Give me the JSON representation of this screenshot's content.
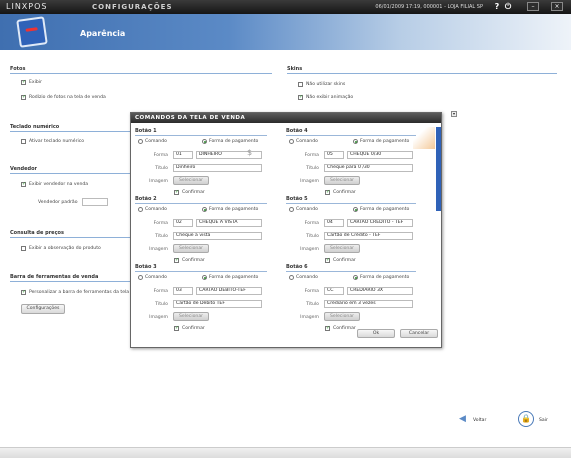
{
  "topbar": {
    "brand": "LINXPOS",
    "title": "CONFIGURAÇÕES",
    "status": "06/01/2009 17:19, 000001 - LOJA FILIAL SP",
    "help_icon": "question-icon",
    "power_icon": "power-icon"
  },
  "header": {
    "title": "Aparência"
  },
  "sections": {
    "fotos": {
      "title": "Fotos",
      "items": [
        {
          "label": "Exibir",
          "checked": true
        },
        {
          "label": "Rodízio de fotos na tela de venda",
          "checked": true
        }
      ]
    },
    "skins": {
      "title": "Skins",
      "items": [
        {
          "label": "Não utilizar skins",
          "checked": false
        },
        {
          "label": "Não exibir animação",
          "checked": true
        }
      ]
    },
    "teclado": {
      "title": "Teclado numérico",
      "items": [
        {
          "label": "Ativar teclado numérico",
          "checked": false
        }
      ]
    },
    "vendedor": {
      "title": "Vendedor",
      "items": [
        {
          "label": "Exibir vendedor na venda",
          "checked": true
        }
      ],
      "padrao_label": "Vendedor padrão",
      "padrao_value": ""
    },
    "consulta": {
      "title": "Consulta de preços",
      "items": [
        {
          "label": "Exibir a observação do produto",
          "checked": false
        }
      ]
    },
    "barra": {
      "title": "Barra de ferramentas de venda",
      "items": [
        {
          "label": "Personalizar a barra de ferramentas da tela de v",
          "checked": true
        }
      ],
      "config_button": "Configurações"
    }
  },
  "modal": {
    "title": "COMANDOS DA TELA DE VENDA",
    "radio_comando": "Comando",
    "radio_forma": "Forma de pagamento",
    "label_forma": "Forma",
    "label_titulo": "Título",
    "label_imagem": "Imagem",
    "select_button": "Selecionar",
    "confirm_label": "Confirmar",
    "ok_button": "Ok",
    "cancel_button": "Cancelar",
    "buttons": [
      {
        "name": "Botão 1",
        "code": "01",
        "desc": "DINHEIRO",
        "titulo": "Dinheiro"
      },
      {
        "name": "Botão 2",
        "code": "02",
        "desc": "CHEQUE A VISTA",
        "titulo": "Cheque a vista"
      },
      {
        "name": "Botão 3",
        "code": "03",
        "desc": "CARTAO DEBITO-TEF",
        "titulo": "Cartão de Débito TEF"
      },
      {
        "name": "Botão 4",
        "code": "05",
        "desc": "CHEQUE 0/30",
        "titulo": "Cheque para 0 /30"
      },
      {
        "name": "Botão 5",
        "code": "04",
        "desc": "CARTAO CREDITO - TEF",
        "titulo": "Cartão de Crédito - TEF"
      },
      {
        "name": "Botão 6",
        "code": "CC",
        "desc": "CREDIARIO 3X",
        "titulo": "Crediario em 3 vezes"
      }
    ],
    "dollar_sign": "$"
  },
  "bottom": {
    "back_label": "Voltar",
    "exit_label": "Sair"
  }
}
